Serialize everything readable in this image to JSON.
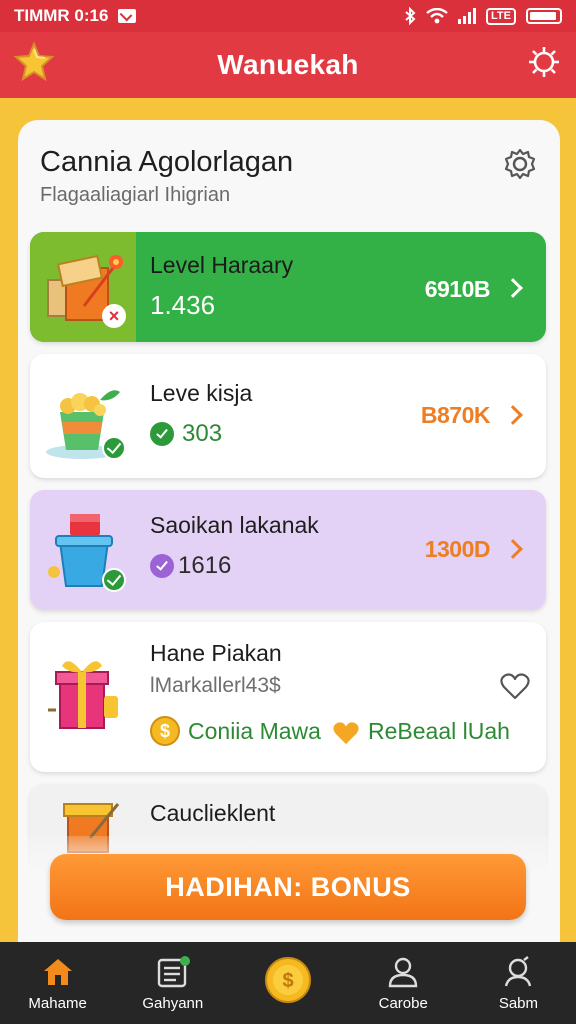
{
  "status_bar": {
    "time": "TIMMR 0:16",
    "network_badge": "LTE"
  },
  "header": {
    "title": "Wanuekah"
  },
  "panel": {
    "title": "Cannia Agolorlagan",
    "subtitle": "Flagaaliagiarl Ihigrian"
  },
  "cards": [
    {
      "title": "Level Haraary",
      "value": "1.436",
      "price": "6910B",
      "theme": "green"
    },
    {
      "title": "Leve kisja",
      "value": "303",
      "price": "B870K",
      "theme": "white"
    },
    {
      "title": "Saoikan lakanak",
      "value": "1616",
      "price": "1300D",
      "theme": "purple"
    },
    {
      "title": "Hane Piakan",
      "subtitle": "lMarkallerl43$",
      "chip1": "Coniia Mawa",
      "chip2": "ReBeaal lUah",
      "theme": "white"
    },
    {
      "title": "Cauclieklent",
      "theme": "white"
    }
  ],
  "bonus_button": {
    "label": "HADIHAN: BONUS"
  },
  "nav": [
    {
      "label": "Mahame",
      "icon": "home-icon"
    },
    {
      "label": "Gahyann",
      "icon": "list-icon"
    },
    {
      "label": "",
      "icon": "coin-icon"
    },
    {
      "label": "Carobe",
      "icon": "user-icon"
    },
    {
      "label": "Sabm",
      "icon": "profile-icon"
    }
  ],
  "colors": {
    "header_red": "#e23a43",
    "background_yellow": "#f5c43a",
    "green_card": "#33b146",
    "purple_card": "#e4d2f6",
    "orange_accent": "#f27416",
    "nav_dark": "#262626"
  }
}
